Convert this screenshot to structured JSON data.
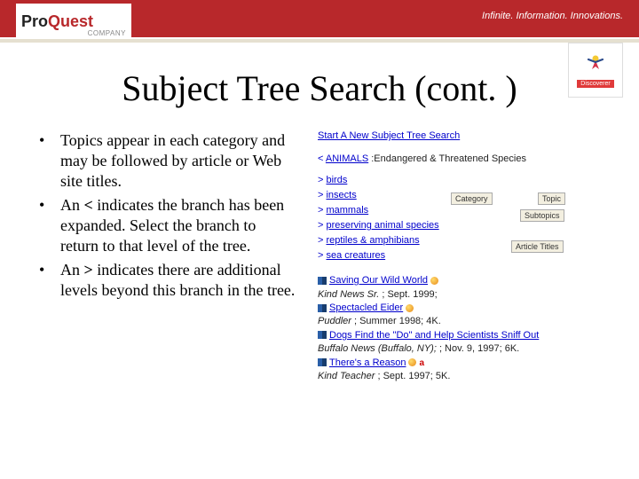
{
  "header": {
    "logo_pro": "Pro",
    "logo_quest": "Quest",
    "logo_sub": "COMPANY",
    "tagline": "Infinite. Information. Innovations.",
    "discoverer": "Discoverer"
  },
  "title": "Subject Tree Search (cont. )",
  "bullets": [
    {
      "pre": "Topics appear in each category and may be followed by article or Web site titles."
    },
    {
      "pre": "An ",
      "bold": "<",
      "post": " indicates the branch has been expanded. Select the branch to return to that level of the tree."
    },
    {
      "pre": "An ",
      "bold": ">",
      "post": " indicates there are additional levels beyond this branch in the tree."
    }
  ],
  "tree": {
    "start_link": "Start A New Subject Tree Search",
    "crumb_sep": "<",
    "crumb_category": "ANIMALS",
    "crumb_trail": ":Endangered & Threatened Species",
    "subtopics": [
      "birds",
      "insects",
      "mammals",
      "preserving animal species",
      "reptiles & amphibians",
      "sea creatures"
    ],
    "labels": {
      "category": "Category",
      "topic": "Topic",
      "subtopics": "Subtopics",
      "articles": "Article Titles"
    },
    "articles": [
      {
        "title": "Saving Our Wild World",
        "meta_italic": "Kind News Sr.",
        "meta_rest": " ; Sept. 1999;",
        "dot": true
      },
      {
        "title": "Spectacled Eider",
        "meta_italic": "Puddler",
        "meta_rest": " ; Summer 1998; 4K.",
        "dot": true
      },
      {
        "title": "Dogs Find the \"Do\" and Help Scientists Sniff Out",
        "meta_italic": "Buffalo News (Buffalo, NY);",
        "meta_rest": " ; Nov. 9, 1997; 6K.",
        "dot": false
      },
      {
        "title": "There's a Reason",
        "meta_italic": "Kind Teacher",
        "meta_rest": " ; Sept. 1997; 5K.",
        "dot": true,
        "red_a": "a"
      }
    ]
  }
}
